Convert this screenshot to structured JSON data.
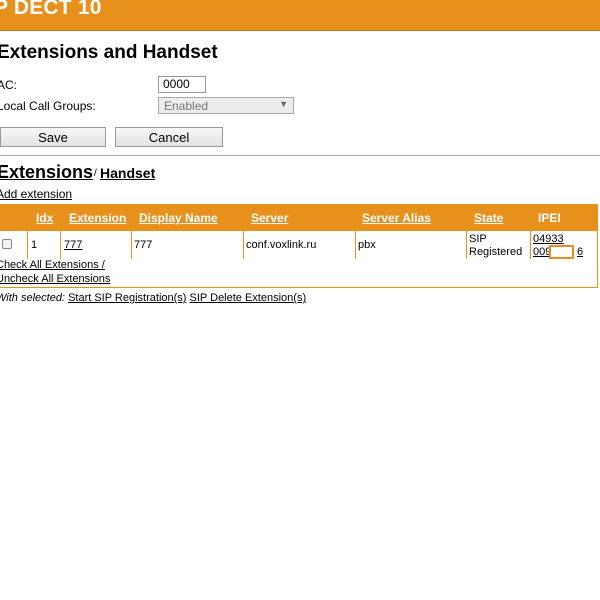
{
  "banner": {
    "title": "P DECT 10"
  },
  "page": {
    "title": "Extensions and Handset"
  },
  "form": {
    "ac_label": "AC:",
    "ac_value": "0000",
    "local_call_groups_label": "Local Call Groups:",
    "local_call_groups_value": "Enabled"
  },
  "buttons": {
    "save": "Save",
    "cancel": "Cancel"
  },
  "section": {
    "extensions_heading": "Extensions",
    "separator": "/",
    "handset_link": "Handset",
    "add_extension": "Add extension"
  },
  "table": {
    "headers": {
      "idx": "Idx",
      "extension": "Extension",
      "display_name": "Display Name",
      "server": "Server",
      "server_alias": "Server Alias",
      "state": "State",
      "ipei": "IPEI"
    },
    "rows": [
      {
        "idx": "1",
        "extension": "777",
        "display_name": "777",
        "server": "conf.voxlink.ru",
        "server_alias": "pbx",
        "state_line1": "SIP",
        "state_line2": "Registered",
        "ipei_line1": "04933",
        "ipei_line2_start": "009",
        "ipei_line2_end": "6"
      }
    ]
  },
  "footer": {
    "check_all": "Check All Extensions /",
    "uncheck_all": "Uncheck All Extensions",
    "with_selected_label": "With selected:",
    "start_sip_registration": "Start SIP Registration(s)",
    "sip_delete_extension": "SIP Delete Extension(s)"
  },
  "colors": {
    "accent": "#e8901c",
    "highlight": "#f08a1e"
  }
}
